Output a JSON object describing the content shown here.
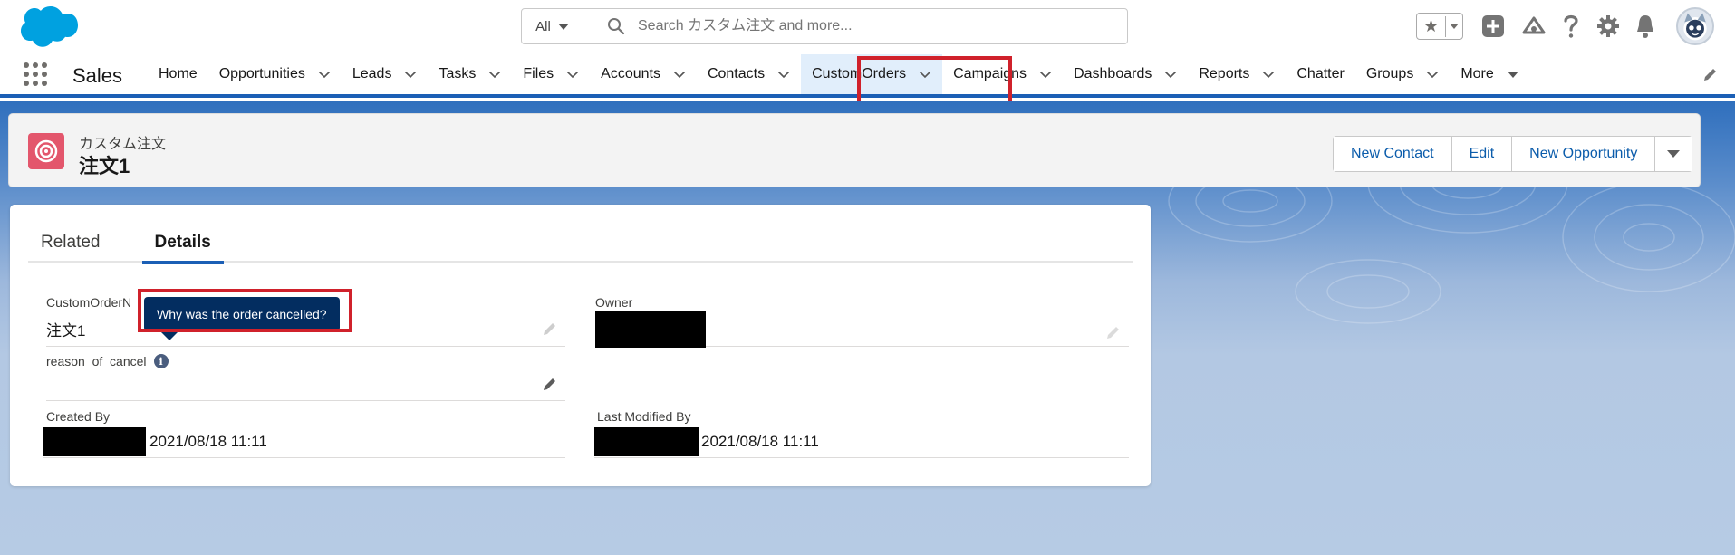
{
  "header": {
    "search": {
      "scope": "All",
      "placeholder": "Search カスタム注文 and more..."
    },
    "icons": [
      "favorites-star-icon",
      "favorites-dropdown-icon",
      "global-actions-icon",
      "trailhead-icon",
      "help-icon",
      "setup-gear-icon",
      "notifications-bell-icon",
      "user-avatar"
    ]
  },
  "nav": {
    "app_name": "Sales",
    "items": [
      {
        "label": "Home",
        "has_menu": false
      },
      {
        "label": "Opportunities",
        "has_menu": true
      },
      {
        "label": "Leads",
        "has_menu": true
      },
      {
        "label": "Tasks",
        "has_menu": true
      },
      {
        "label": "Files",
        "has_menu": true
      },
      {
        "label": "Accounts",
        "has_menu": true
      },
      {
        "label": "Contacts",
        "has_menu": true
      },
      {
        "label": "CustomOrders",
        "has_menu": true,
        "active": true
      },
      {
        "label": "Campaigns",
        "has_menu": true
      },
      {
        "label": "Dashboards",
        "has_menu": true
      },
      {
        "label": "Reports",
        "has_menu": true
      },
      {
        "label": "Chatter",
        "has_menu": false
      },
      {
        "label": "Groups",
        "has_menu": true
      },
      {
        "label": "More",
        "has_menu": true
      }
    ]
  },
  "record": {
    "object_type": "カスタム注文",
    "title": "注文1",
    "actions": {
      "new_contact": "New Contact",
      "edit": "Edit",
      "new_opportunity": "New Opportunity"
    }
  },
  "tabs": {
    "related": "Related",
    "details": "Details"
  },
  "fields": {
    "custom_order_name": {
      "label": "CustomOrderN",
      "value": "注文1"
    },
    "owner": {
      "label": "Owner"
    },
    "reason_of_cancel": {
      "label": "reason_of_cancel",
      "value": ""
    },
    "created_by": {
      "label": "Created By",
      "date": "2021/08/18 11:11"
    },
    "last_modified_by": {
      "label": "Last Modified By",
      "date": "2021/08/18 11:11"
    }
  },
  "tooltip": {
    "text": "Why was the order cancelled?"
  },
  "colors": {
    "brand": "#1b5fb5",
    "link": "#0b5cab",
    "highlight_box": "#d0212b",
    "tooltip_bg": "#032d60",
    "object_icon": "#e3566c"
  }
}
